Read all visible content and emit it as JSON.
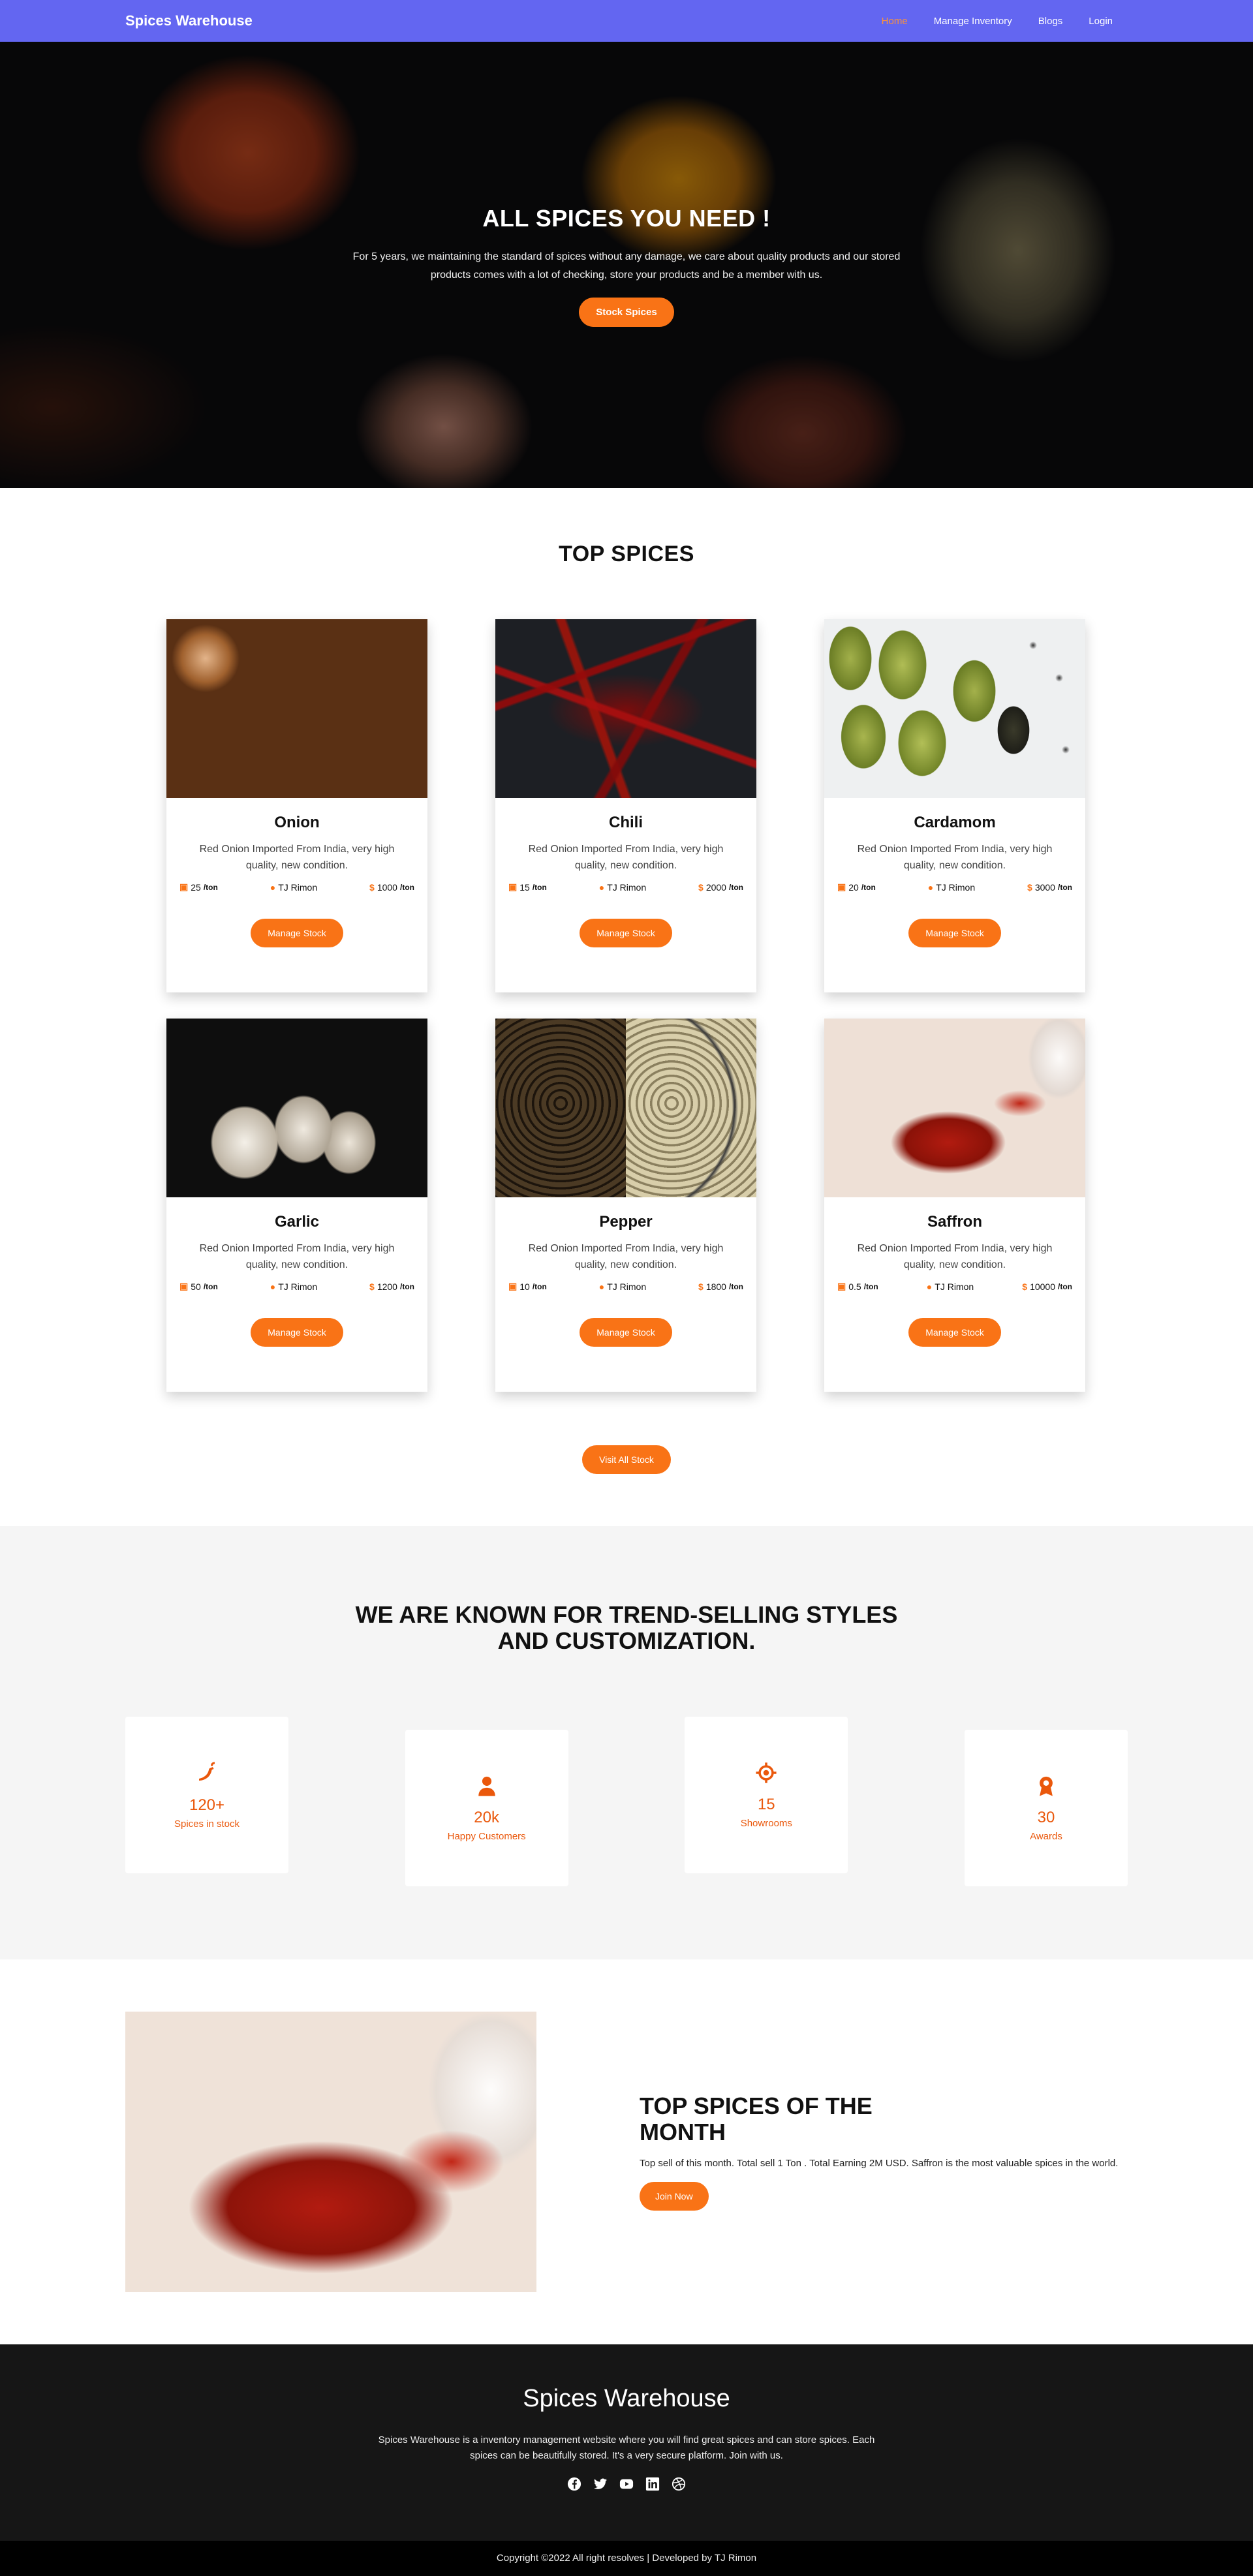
{
  "nav": {
    "brand": "Spices Warehouse",
    "links": [
      "Home",
      "Manage Inventory",
      "Blogs",
      "Login"
    ]
  },
  "hero": {
    "title": "ALL SPICES YOU NEED !",
    "text": "For 5 years, we maintaining the standard of spices without any damage, we care about quality products and our stored products comes with a lot of checking, store your products and be a member with us.",
    "button": "Stock Spices"
  },
  "spices": {
    "title": "TOP SPICES",
    "manage_label": "Manage Stock",
    "unit": "/ton",
    "visit_label": "Visit All Stock",
    "items": [
      {
        "name": "Onion",
        "desc": "Red Onion Imported From India, very high quality, new condition.",
        "qty": "25",
        "supplier": "TJ Rimon",
        "price": "1000"
      },
      {
        "name": "Chili",
        "desc": "Red Onion Imported From India, very high quality, new condition.",
        "qty": "15",
        "supplier": "TJ Rimon",
        "price": "2000"
      },
      {
        "name": "Cardamom",
        "desc": "Red Onion Imported From India, very high quality, new condition.",
        "qty": "20",
        "supplier": "TJ Rimon",
        "price": "3000"
      },
      {
        "name": "Garlic",
        "desc": "Red Onion Imported From India, very high quality, new condition.",
        "qty": "50",
        "supplier": "TJ Rimon",
        "price": "1200"
      },
      {
        "name": "Pepper",
        "desc": "Red Onion Imported From India, very high quality, new condition.",
        "qty": "10",
        "supplier": "TJ Rimon",
        "price": "1800"
      },
      {
        "name": "Saffron",
        "desc": "Red Onion Imported From India, very high quality, new condition.",
        "qty": "0.5",
        "supplier": "TJ Rimon",
        "price": "10000"
      }
    ]
  },
  "known": {
    "title": "WE ARE KNOWN FOR TREND-SELLING STYLES AND CUSTOMIZATION.",
    "stats": [
      {
        "icon": "chili-pepper-icon",
        "value": "120+",
        "label": "Spices in stock"
      },
      {
        "icon": "customer-icon",
        "value": "20k",
        "label": "Happy Customers"
      },
      {
        "icon": "location-target-icon",
        "value": "15",
        "label": "Showrooms"
      },
      {
        "icon": "award-icon",
        "value": "30",
        "label": "Awards"
      }
    ]
  },
  "month": {
    "title": "TOP SPICES OF THE MONTH",
    "text": "Top sell of this month. Total sell 1 Ton . Total Earning 2M USD. Saffron is the most valuable spices in the world.",
    "button": "Join Now"
  },
  "footer": {
    "title": "Spices Warehouse",
    "text": "Spices Warehouse is a inventory management website where you will find great spices and can store spices. Each spices can be beautifully stored. It's a very secure platform. Join with us.",
    "socials": [
      "facebook-icon",
      "twitter-icon",
      "youtube-icon",
      "linkedin-icon",
      "dribbble-icon"
    ],
    "copyright": "Copyright ©2022 All right resolves | Developed by TJ Rimon"
  },
  "colors": {
    "nav": "#6366f1",
    "accent": "#f97316",
    "footer": "#161616"
  }
}
